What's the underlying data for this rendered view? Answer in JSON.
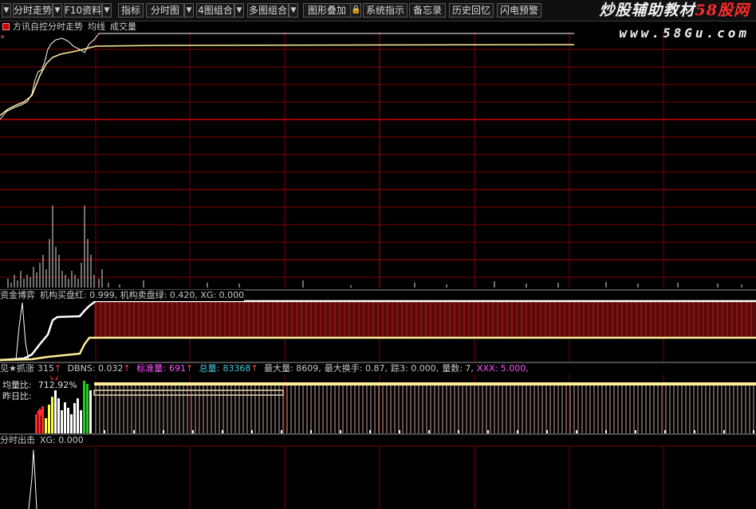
{
  "toolbar": {
    "items": [
      {
        "label": "分时走势",
        "has_arrow": true
      },
      {
        "label": "F10资料",
        "has_arrow": true
      },
      {
        "label": "指标",
        "has_arrow": false
      },
      {
        "label": "分时图",
        "has_arrow": true
      },
      {
        "label": "4图组合",
        "has_arrow": true
      },
      {
        "label": "多图组合",
        "has_arrow": true
      },
      {
        "label": "图形叠加",
        "has_arrow": false
      },
      {
        "label": "系统指示",
        "has_arrow": false
      },
      {
        "label": "备忘录",
        "has_arrow": false
      },
      {
        "label": "历史回忆",
        "has_arrow": false
      },
      {
        "label": "闪电预警",
        "has_arrow": false
      }
    ]
  },
  "watermark": {
    "title_main": "炒股辅助教材",
    "title_accent": "58股网",
    "url": "www.58Gu.com"
  },
  "main_panel": {
    "title": "方讯自控分时走势",
    "indicator_1": "均线",
    "indicator_2": "成交量"
  },
  "panel_2": {
    "name": "资金博弈",
    "text": "机构买盘红: 0.999, 机构卖盘绿: 0.420, XG: 0.000"
  },
  "panel_3": {
    "name": "见★抓涨",
    "value": "315",
    "dbns": "DBNS: 0.032",
    "standard_label": "标准量:",
    "standard_value": "691",
    "total_label": "总量:",
    "total_value": "83368",
    "max_vol": "最大量: 8609,",
    "max_turnover": "最大换手: 0.87,",
    "jump3": "踪3: 0.000,",
    "vol_count": "量数: 7,",
    "xxx": "XXX: 5.000,",
    "ratio_label": "均量比:",
    "ratio_value": "712.92%",
    "prev_ratio_label": "昨日比:"
  },
  "panel_4": {
    "name": "分时出击",
    "text": "XG: 0.000"
  },
  "colors": {
    "grid": "#7a0000",
    "grid_bright": "#b00000",
    "price_line": "#ffffff",
    "avg_line": "#ffee99",
    "dim_text": "#c8c8c8",
    "magenta": "#ff55ff",
    "cyan": "#44ccdd",
    "red": "#ff2a2a",
    "green": "#22cc22",
    "yellow": "#ffff44"
  }
}
